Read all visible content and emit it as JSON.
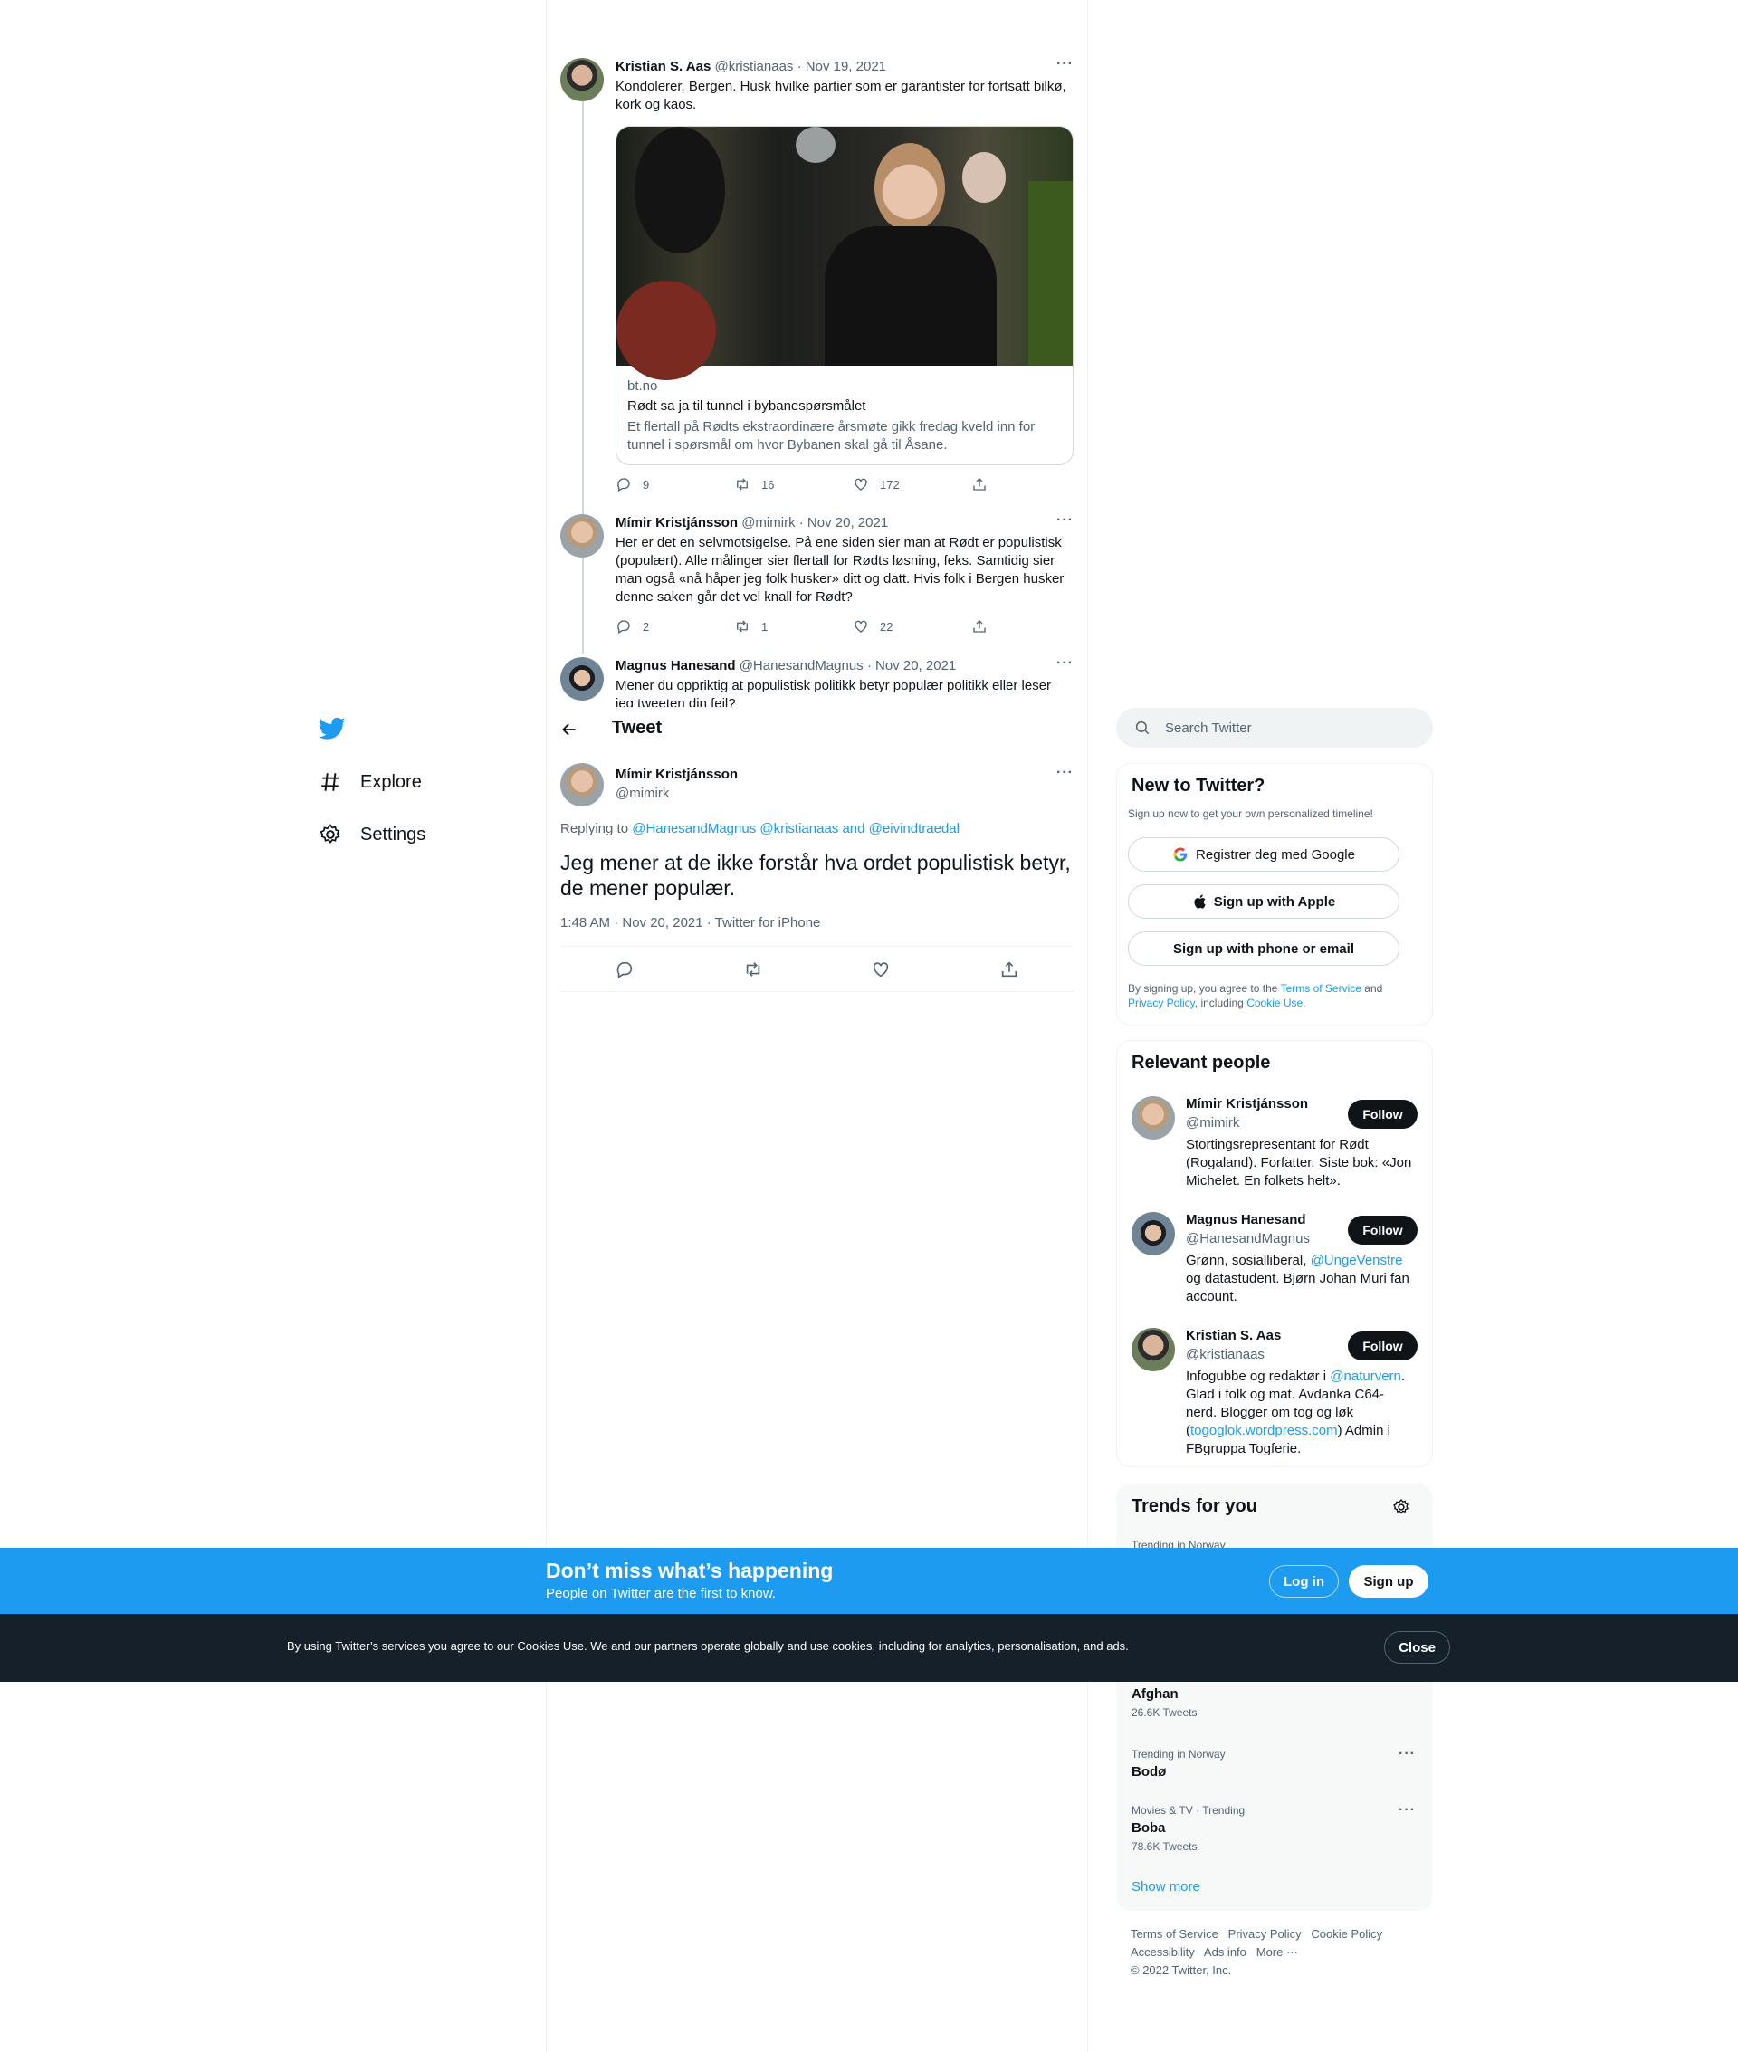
{
  "thread": [
    {
      "name": "Kristian S. Aas",
      "handle": "@kristianaas",
      "date": "· Nov 19, 2021",
      "text_line1": "Kondolerer, Bergen. Husk hvilke partier som er garantister for fortsatt bilkø,",
      "text_line2": "kork og kaos.",
      "card": {
        "domain": "bt.no",
        "title": "Rødt sa ja til tunnel i bybanespørsmålet",
        "desc_line1": "Et flertall på Rødts ekstraordinære årsmøte gikk fredag kveld inn for",
        "desc_line2": "tunnel i spørsmål om hvor Bybanen skal gå til Åsane."
      },
      "replies": "9",
      "retweets": "16",
      "likes": "172"
    },
    {
      "name": "Mímir Kristjánsson",
      "handle": "@mimirk",
      "date": "· Nov 20, 2021",
      "lines": [
        "Her er det en selvmotsigelse. På ene siden sier man at Rødt er populistisk",
        "(populært). Alle målinger sier flertall for Rødts løsning, feks. Samtidig sier",
        "man også «nå håper jeg folk husker» ditt og datt. Hvis folk i Bergen husker",
        "denne saken går det vel knall for Rødt?"
      ],
      "replies": "2",
      "retweets": "1",
      "likes": "22"
    },
    {
      "name": "Magnus Hanesand",
      "handle": "@HanesandMagnus",
      "date": "· Nov 20, 2021",
      "text_line1": "Mener du oppriktig at populistisk politikk betyr populær politikk eller leser",
      "text_line2": "jeg tweeten din feil?"
    }
  ],
  "header": {
    "title": "Tweet"
  },
  "main_tweet": {
    "name": "Mímir Kristjánsson",
    "handle": "@mimirk",
    "replying_label": "Replying to",
    "replying_handles": "@HanesandMagnus @kristianaas",
    "replying_and": "and",
    "replying_last": "@eivindtraedal",
    "text_line1": "Jeg mener at de ikke forstår hva ordet populistisk betyr,",
    "text_line2": "de mener populær.",
    "timestamp": "1:48 AM · Nov 20, 2021 · Twitter for iPhone"
  },
  "nav": {
    "explore": "Explore",
    "settings": "Settings"
  },
  "search": {
    "placeholder": "Search Twitter"
  },
  "new_to_twitter": {
    "title": "New to Twitter?",
    "subtitle": "Sign up now to get your own personalized timeline!",
    "google": "Registrer deg med Google",
    "apple": "Sign up with Apple",
    "phone": "Sign up with phone or email",
    "legal_1": "By signing up, you agree to the",
    "tos": "Terms of Service",
    "and": "and",
    "privacy": "Privacy Policy",
    "legal_2": ", including",
    "cookie": "Cookie Use."
  },
  "relevant_people": {
    "title": "Relevant people",
    "follow_label": "Follow",
    "people": [
      {
        "name": "Mímir Kristjánsson",
        "handle": "@mimirk",
        "bio_1": "Stortingsrepresentant for Rødt",
        "bio_2": "(Rogaland). Forfatter. Siste bok: «Jon",
        "bio_3": "Michelet. En folkets helt»."
      },
      {
        "name": "Magnus Hanesand",
        "handle": "@HanesandMagnus",
        "bio_1a": "Grønn, sosialliberal,",
        "bio_1b": "@UngeVenstre",
        "bio_2": "og datastudent. Bjørn Johan Muri fan",
        "bio_3": "account."
      },
      {
        "name": "Kristian S. Aas",
        "handle": "@kristianaas",
        "bio_1a": "Infogubbe og redaktør i",
        "bio_1b": "@naturvern",
        "bio_1c": ".",
        "bio_2": "Glad i folk og mat. Avdanka C64-",
        "bio_3": "nerd. Blogger om tog og løk",
        "bio_4a": "(",
        "bio_4b": "togoglok.wordpress.com",
        "bio_4c": ") Admin i",
        "bio_5": "FBgruppa Togferie."
      }
    ]
  },
  "trends": {
    "title": "Trends for you",
    "partial_meta": "Trending in Norway",
    "items": [
      {
        "name": "Afghan",
        "count": "26.6K Tweets"
      },
      {
        "meta": "Trending in Norway",
        "name": "Bodø"
      },
      {
        "meta": "Movies & TV · Trending",
        "name": "Boba",
        "count": "78.6K Tweets"
      }
    ],
    "show_more": "Show more"
  },
  "footer": {
    "terms": "Terms of Service",
    "privacy": "Privacy Policy",
    "cookie": "Cookie Policy",
    "accessibility": "Accessibility",
    "ads": "Ads info",
    "more": "More ···",
    "copyright": "© 2022 Twitter, Inc."
  },
  "bottom_bar": {
    "headline": "Don’t miss what’s happening",
    "subline": "People on Twitter are the first to know.",
    "login": "Log in",
    "signup": "Sign up"
  },
  "cookie_bar": {
    "text": "By using Twitter’s services you agree to our Cookies Use. We and our partners operate globally and use cookies, including for analytics, personalisation, and ads.",
    "close": "Close"
  },
  "colors": {
    "accent": "#1d9bf0",
    "text": "#0f1419",
    "muted": "#536471",
    "cookie_bg": "#15202b"
  }
}
